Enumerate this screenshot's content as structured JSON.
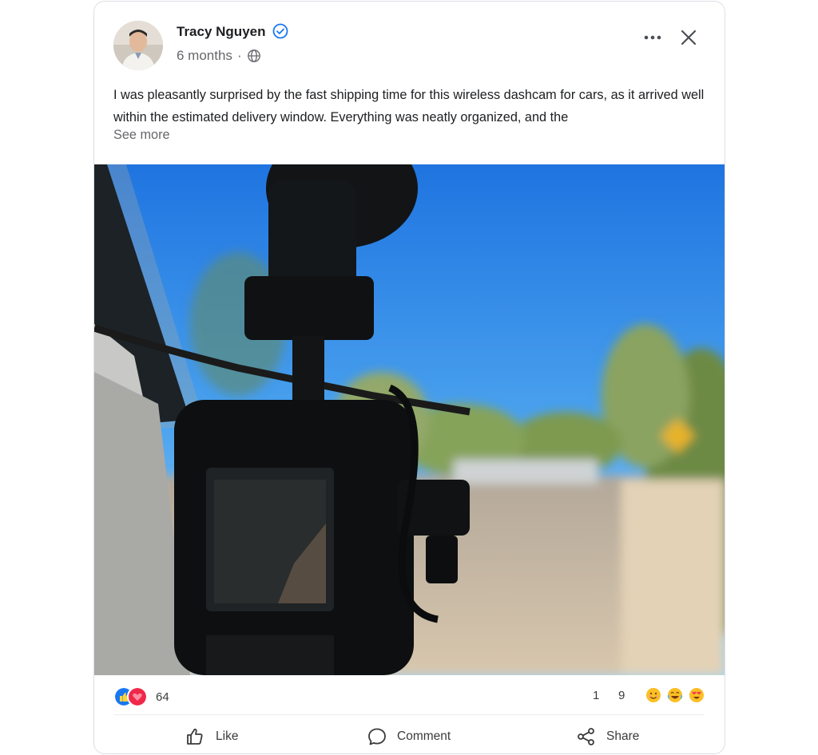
{
  "post": {
    "author": "Tracy Nguyen",
    "time": "6 months",
    "separator": "·",
    "text": "I was pleasantly surprised by the fast shipping time for this wireless dashcam for cars, as it arrived well within the estimated delivery window. Everything was neatly organized, and the",
    "see_more": "See more",
    "reaction_count": "64",
    "comment_count": "1",
    "share_count": "9"
  },
  "actions": {
    "like": "Like",
    "comment": "Comment",
    "share": "Share"
  },
  "colors": {
    "like_blue": "#1877f2",
    "love_red": "#f02849",
    "verified_blue": "#1877f2",
    "sky": "#3a8ee6"
  },
  "icons": [
    "verified-icon",
    "globe-icon",
    "more-icon",
    "close-icon",
    "like-reaction-icon",
    "love-reaction-icon",
    "smile-emoji-icon",
    "laugh-emoji-icon",
    "heart-eyes-emoji-icon",
    "thumbs-up-icon",
    "comment-icon",
    "share-icon"
  ]
}
